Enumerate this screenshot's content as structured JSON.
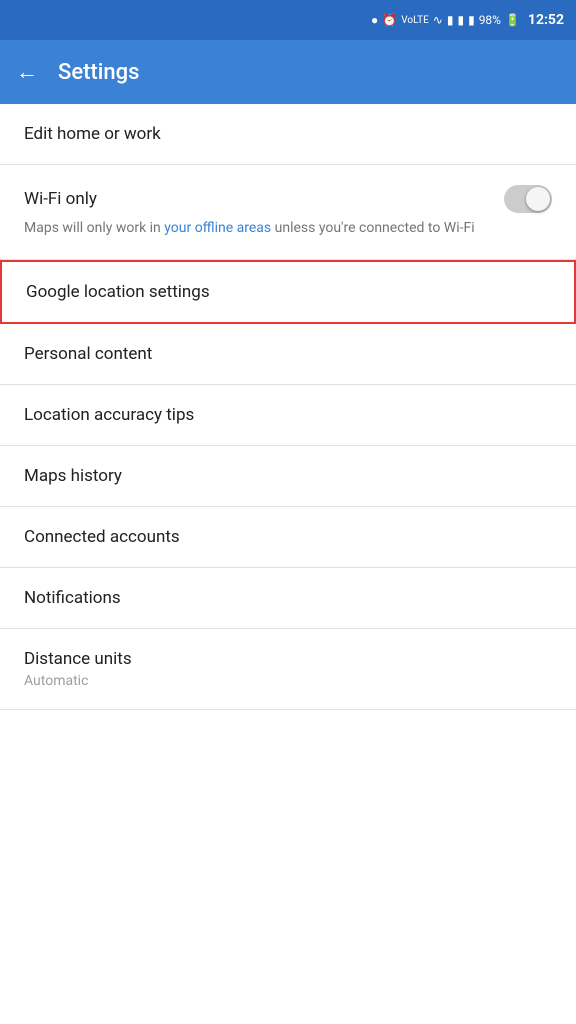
{
  "statusBar": {
    "icons": [
      "location",
      "alarm",
      "volte",
      "wifi",
      "notification",
      "signal1",
      "signal2",
      "battery",
      "time"
    ],
    "battery": "98%",
    "time": "12:52"
  },
  "appBar": {
    "title": "Settings",
    "backLabel": "←"
  },
  "settingsItems": [
    {
      "id": "edit-home-work",
      "title": "Edit home or work",
      "subtitle": null,
      "highlighted": false
    },
    {
      "id": "wifi-only",
      "title": "Wi-Fi only",
      "subtitle": "Maps will only work in your offline areas unless you're connected to Wi-Fi",
      "subtitleLink": "your offline areas",
      "highlighted": false,
      "toggle": true,
      "toggleOn": false
    },
    {
      "id": "google-location-settings",
      "title": "Google location settings",
      "subtitle": null,
      "highlighted": true
    },
    {
      "id": "personal-content",
      "title": "Personal content",
      "subtitle": null,
      "highlighted": false
    },
    {
      "id": "location-accuracy-tips",
      "title": "Location accuracy tips",
      "subtitle": null,
      "highlighted": false
    },
    {
      "id": "maps-history",
      "title": "Maps history",
      "subtitle": null,
      "highlighted": false
    },
    {
      "id": "connected-accounts",
      "title": "Connected accounts",
      "subtitle": null,
      "highlighted": false
    },
    {
      "id": "notifications",
      "title": "Notifications",
      "subtitle": null,
      "highlighted": false
    },
    {
      "id": "distance-units",
      "title": "Distance units",
      "subtitle": "Automatic",
      "highlighted": false
    }
  ],
  "colors": {
    "statusBar": "#2a6bbf",
    "appBar": "#3b82d4",
    "highlight": "#e53935",
    "linkColor": "#3b82d4"
  }
}
